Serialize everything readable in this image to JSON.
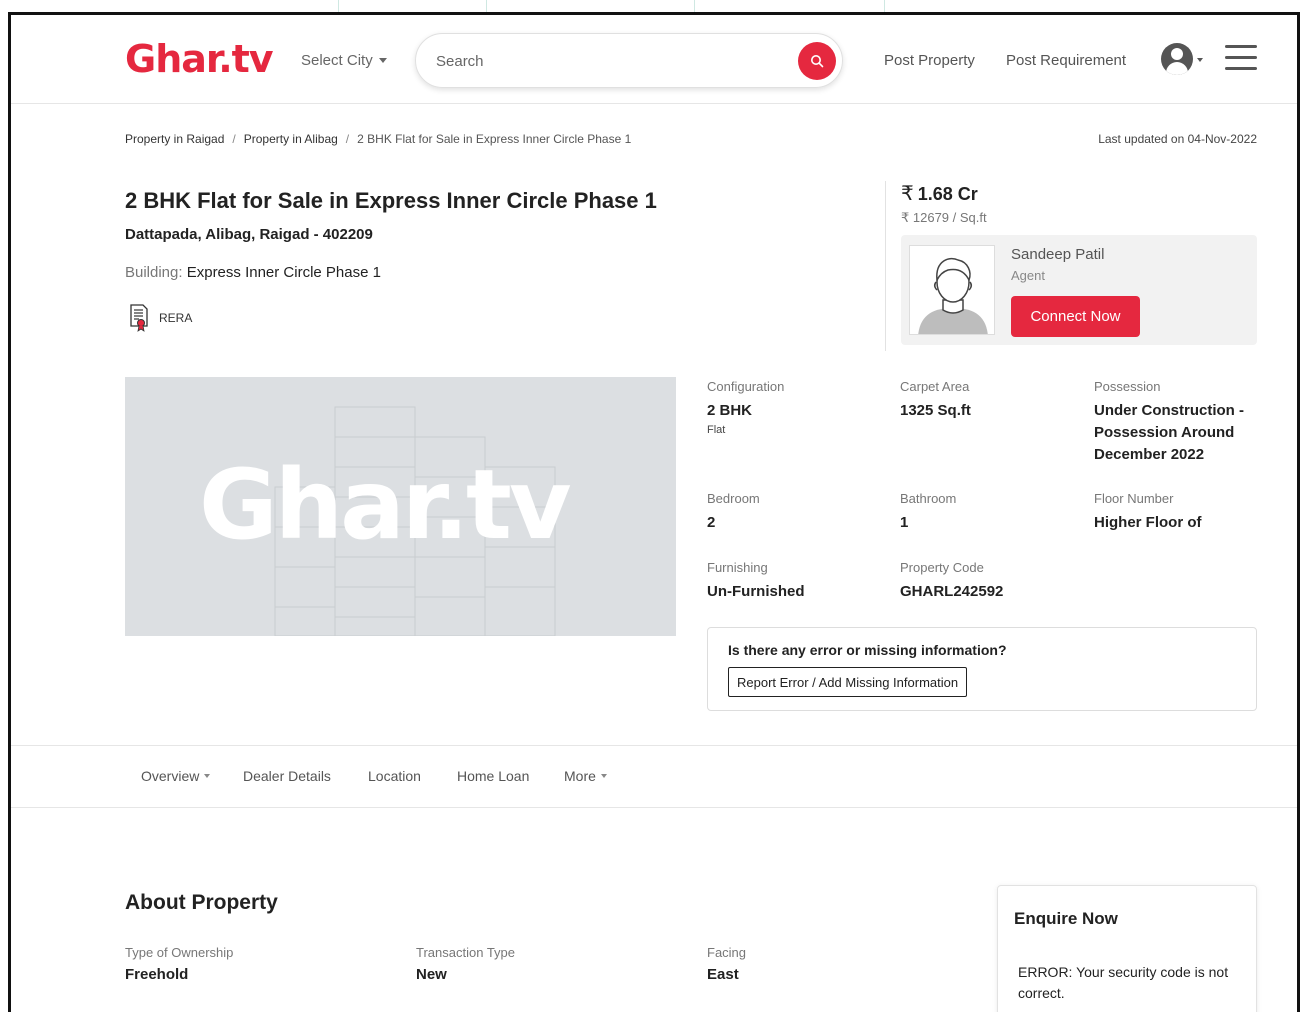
{
  "header": {
    "logo": "Ghar.tv",
    "city_select": "Select City",
    "search_placeholder": "Search",
    "post_property": "Post Property",
    "post_requirement": "Post Requirement"
  },
  "breadcrumb": [
    "Property in Raigad",
    "Property in Alibag",
    "2 BHK Flat for Sale in Express Inner Circle Phase 1"
  ],
  "last_updated": "Last updated on 04-Nov-2022",
  "listing": {
    "title": "2 BHK Flat for Sale in Express Inner Circle Phase 1",
    "address": "Dattapada, Alibag, Raigad - 402209",
    "building_label": "Building:",
    "building_name": "Express Inner Circle Phase 1",
    "rera": "RERA"
  },
  "pricing": {
    "currency": "₹",
    "price": "1.68 Cr",
    "per_sqft": "₹ 12679 / Sq.ft"
  },
  "agent": {
    "name": "Sandeep Patil",
    "role": "Agent",
    "connect_label": "Connect Now"
  },
  "photo_watermark": "Ghar.tv",
  "specs": {
    "configuration": {
      "label": "Configuration",
      "value": "2 BHK",
      "sub": "Flat"
    },
    "carpet_area": {
      "label": "Carpet Area",
      "value": "1325 Sq.ft"
    },
    "possession": {
      "label": "Possession",
      "value": "Under Construction - Possession Around December 2022"
    },
    "bedroom": {
      "label": "Bedroom",
      "value": "2"
    },
    "bathroom": {
      "label": "Bathroom",
      "value": "1"
    },
    "floor_number": {
      "label": "Floor Number",
      "value": "Higher Floor of"
    },
    "furnishing": {
      "label": "Furnishing",
      "value": "Un-Furnished"
    },
    "property_code": {
      "label": "Property Code",
      "value": "GHARL242592"
    }
  },
  "error_box": {
    "question": "Is there any error or missing information?",
    "button": "Report Error / Add Missing Information"
  },
  "tabs": [
    "Overview",
    "Dealer Details",
    "Location",
    "Home Loan",
    "More"
  ],
  "about": {
    "title": "About Property",
    "fields": [
      {
        "label": "Type of Ownership",
        "value": "Freehold"
      },
      {
        "label": "Transaction Type",
        "value": "New"
      },
      {
        "label": "Facing",
        "value": "East"
      }
    ]
  },
  "enquire": {
    "title": "Enquire Now",
    "error": "ERROR: Your security code is not correct."
  },
  "colors": {
    "brand": "#e5283f"
  }
}
